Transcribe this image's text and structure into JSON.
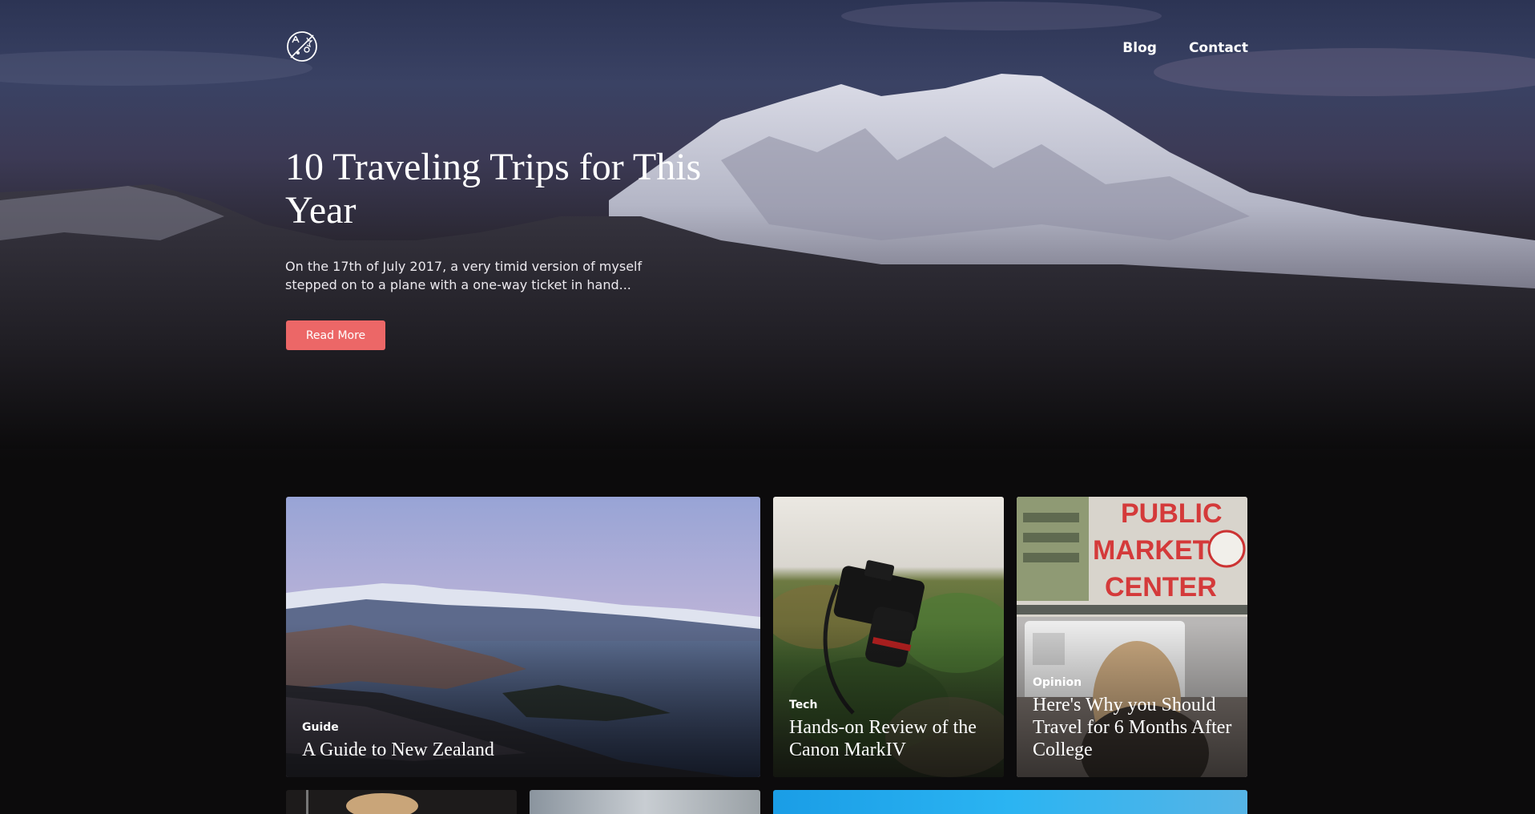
{
  "header": {
    "logo": "compass-logo-icon",
    "nav": [
      {
        "label": "Blog"
      },
      {
        "label": "Contact"
      }
    ]
  },
  "hero": {
    "title": "10 Traveling Trips for This Year",
    "excerpt": "On the 17th of July 2017, a very timid version of myself stepped on to a plane with a one-way ticket in hand...",
    "cta_label": "Read More"
  },
  "posts": [
    {
      "category": "Guide",
      "title": "A Guide to New Zealand"
    },
    {
      "category": "Tech",
      "title": "Hands-on Review of the Canon MarkIV"
    },
    {
      "category": "Opinion",
      "title": "Here's Why you Should Travel for 6 Months After College"
    }
  ],
  "colors": {
    "accent": "#ec6767",
    "background": "#0c0b0c"
  }
}
